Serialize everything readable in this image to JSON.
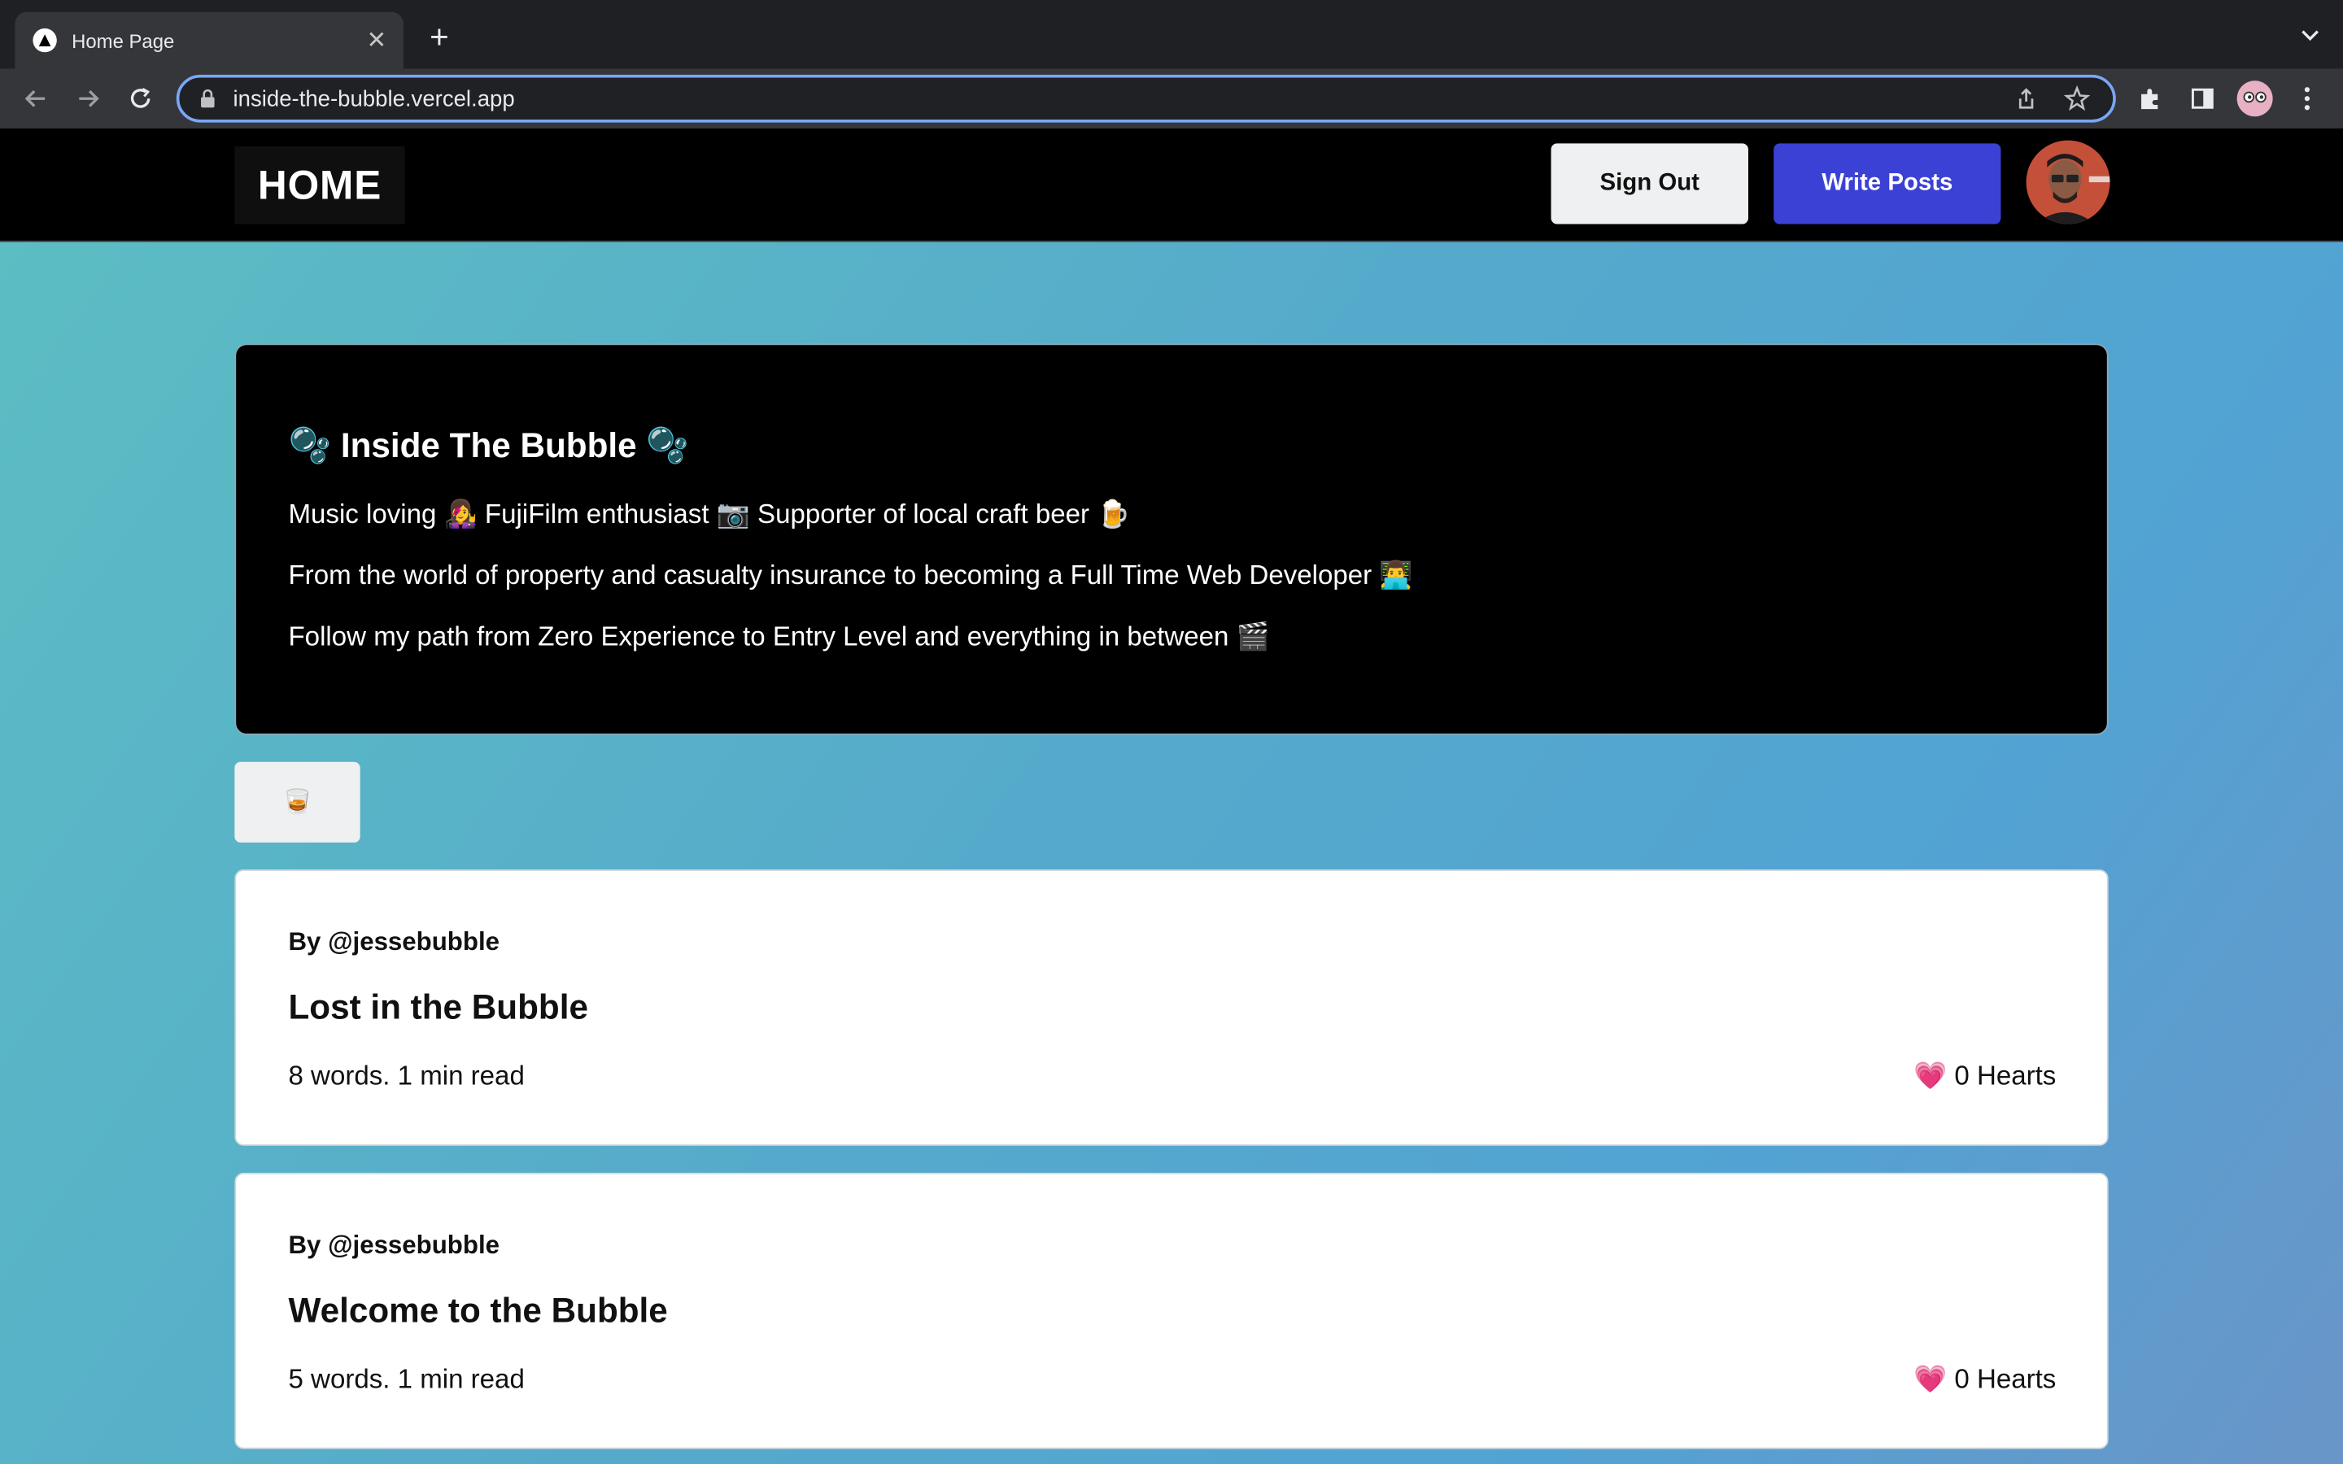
{
  "browser": {
    "tab_title": "Home Page",
    "url": "inside-the-bubble.vercel.app"
  },
  "header": {
    "logo": "HOME",
    "sign_out": "Sign Out",
    "write_posts": "Write Posts"
  },
  "hero": {
    "title": "🫧 Inside The Bubble 🫧",
    "lines": [
      "Music loving 👩‍🎤 FujiFilm enthusiast 📷 Supporter of local craft beer 🍺",
      "From the world of property and casualty insurance to becoming a Full Time Web Developer 👨‍💻",
      "Follow my path from Zero Experience to Entry Level and everything in between 🎬"
    ]
  },
  "feed_button": "🥃",
  "posts": [
    {
      "author": "By @jessebubble",
      "title": "Lost in the Bubble",
      "meta": "8 words. 1 min read",
      "hearts": "💗 0 Hearts"
    },
    {
      "author": "By @jessebubble",
      "title": "Welcome to the Bubble",
      "meta": "5 words. 1 min read",
      "hearts": "💗 0 Hearts"
    }
  ],
  "colors": {
    "accent": "#3c41d5",
    "gradient_start": "#5cbdc3",
    "gradient_end": "#6a95c8"
  }
}
